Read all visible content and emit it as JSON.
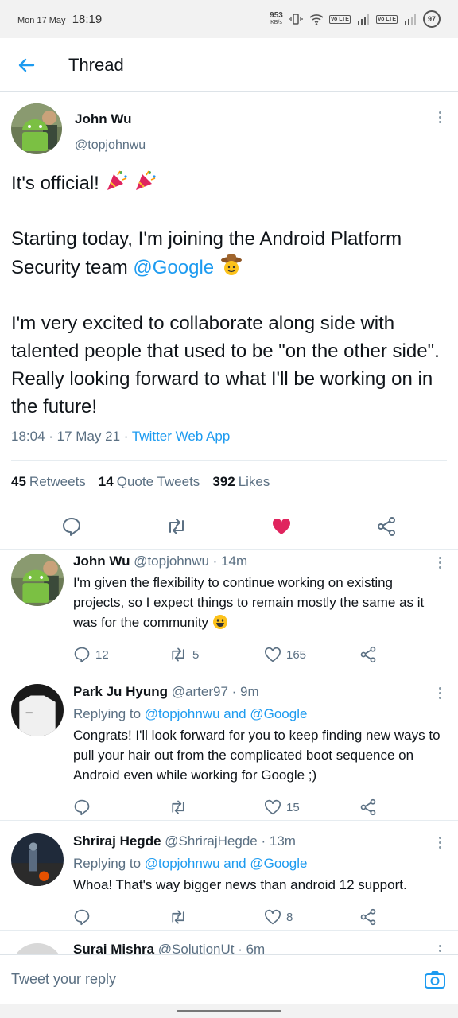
{
  "status_bar": {
    "date": "Mon 17 May",
    "time": "18:19",
    "net_speed_value": "953",
    "net_speed_unit": "KB/s",
    "battery": "97",
    "volte_label": "Vo LTE"
  },
  "header": {
    "title": "Thread"
  },
  "main_tweet": {
    "name": "John Wu",
    "handle": "@topjohnwu",
    "line1": "It's official!",
    "line2a": "Starting today, I'm joining the Android Platform Security team ",
    "mention": "@Google",
    "line3": "I'm very excited to collaborate along side with talented people that used to be \"on the other side\". Really looking forward to what I'll be working on in the future!",
    "time": "18:04 · 17 May 21 · ",
    "source": "Twitter Web App",
    "retweets_count": "45",
    "retweets_label": "Retweets",
    "quotes_count": "14",
    "quotes_label": "Quote Tweets",
    "likes_count": "392",
    "likes_label": "Likes",
    "liked_color": "#e0245e"
  },
  "replies": [
    {
      "name": "John Wu",
      "handle": "@topjohnwu · 14m",
      "body": "I'm given the flexibility to continue working on existing projects, so I expect things to remain mostly the same as it was for the community",
      "reply_count": "12",
      "retweet_count": "5",
      "like_count": "165"
    },
    {
      "name": "Park Ju Hyung",
      "handle": "@arter97 · 9m",
      "replying_prefix": "Replying to ",
      "replying_targets": "@topjohnwu and @Google",
      "body": "Congrats! I'll look forward for you to keep finding new ways to pull your hair out from the complicated boot sequence on Android even while working for Google ;)",
      "reply_count": "",
      "retweet_count": "",
      "like_count": "15"
    },
    {
      "name": "Shriraj Hegde",
      "handle": "@ShrirajHegde · 13m",
      "replying_prefix": "Replying to ",
      "replying_targets": "@topjohnwu and @Google",
      "body": "Whoa! That's way bigger news than android 12 support.",
      "reply_count": "",
      "retweet_count": "",
      "like_count": "8"
    },
    {
      "name": "Suraj Mishra",
      "handle": "@SolutionUt · 6m"
    }
  ],
  "composer": {
    "placeholder": "Tweet your reply"
  }
}
